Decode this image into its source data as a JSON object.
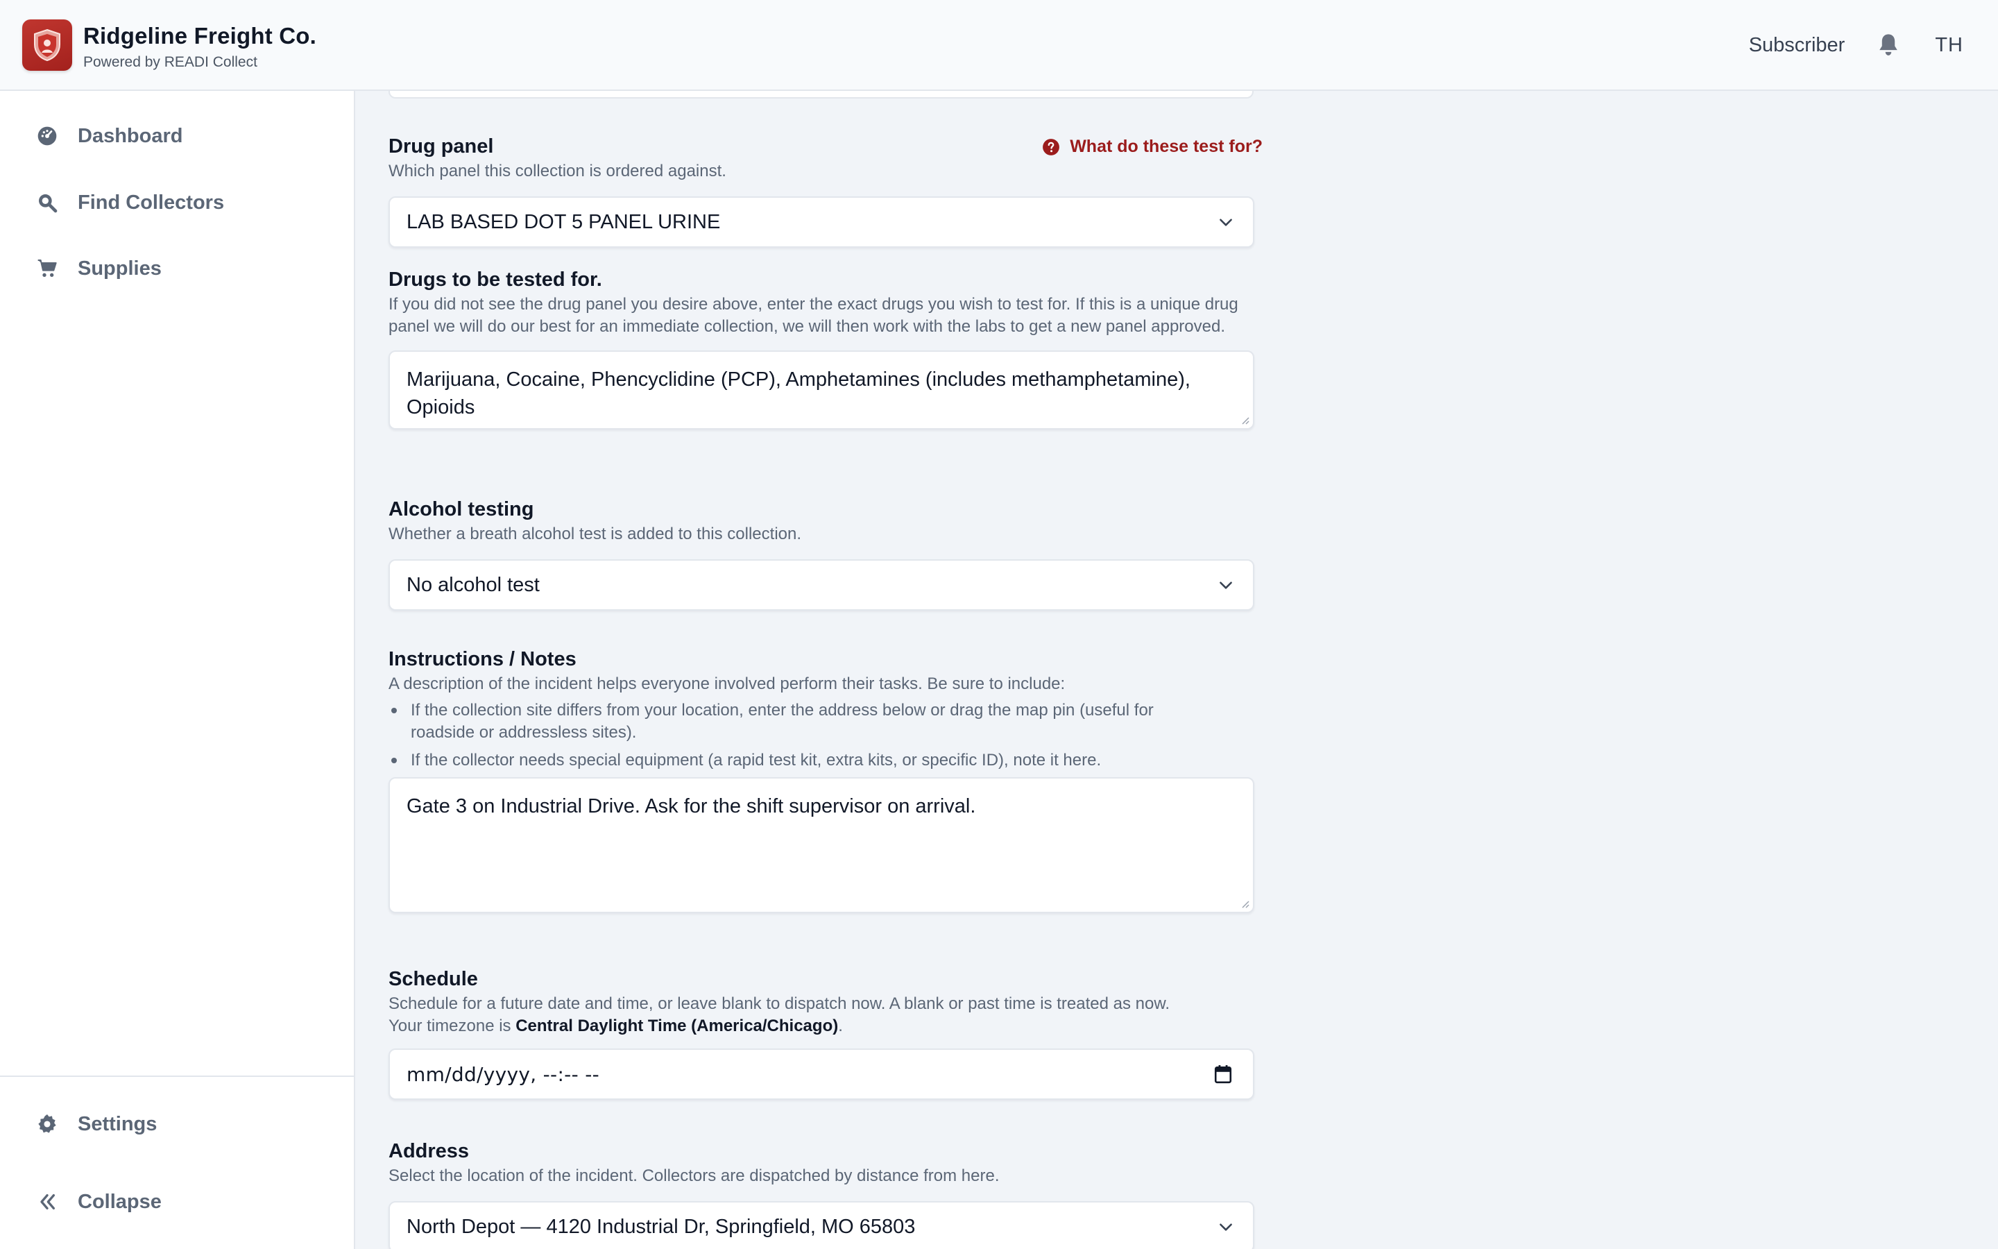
{
  "header": {
    "app_title": "Ridgeline Freight Co.",
    "app_subtitle": "Powered by READI Collect",
    "role": "Subscriber",
    "user_initials": "TH"
  },
  "sidebar": {
    "items": [
      {
        "label": "Dashboard",
        "icon": "dashboard-icon"
      },
      {
        "label": "Find Collectors",
        "icon": "search-icon"
      },
      {
        "label": "Supplies",
        "icon": "cart-icon"
      }
    ],
    "bottom_items": [
      {
        "label": "Settings",
        "icon": "gear-icon"
      },
      {
        "label": "Collapse",
        "icon": "double-chevron-left-icon"
      }
    ]
  },
  "form": {
    "drug_panel": {
      "label": "Drug panel",
      "help_link": "What do these test for?",
      "hint": "Which panel this collection is ordered against.",
      "value": "LAB BASED DOT 5 PANEL URINE"
    },
    "drugs_tested": {
      "label": "Drugs to be tested for.",
      "hint": "If you did not see the drug panel you desire above, enter the exact drugs you wish to test for. If this is a unique drug panel we will do our best for an immediate collection, we will then work with the labs to get a new panel approved.",
      "value": "Marijuana, Cocaine, Phencyclidine (PCP), Amphetamines (includes methamphetamine), Opioids"
    },
    "alcohol": {
      "label": "Alcohol testing",
      "hint": "Whether a breath alcohol test is added to this collection.",
      "value": "No alcohol test"
    },
    "notes": {
      "label": "Instructions / Notes",
      "hint": "A description of the incident helps everyone involved perform their tasks. Be sure to include:",
      "bullets": [
        "If the collection site differs from your location, enter the address below or drag the map pin (useful for roadside or addressless sites).",
        "If the collector needs special equipment (a rapid test kit, extra kits, or specific ID), note it here."
      ],
      "value": "Gate 3 on Industrial Drive. Ask for the shift supervisor on arrival."
    },
    "schedule": {
      "label": "Schedule",
      "hint_line1": "Schedule for a future date and time, or leave blank to dispatch now. A blank or past time is treated as now.",
      "hint_prefix": "Your timezone is ",
      "timezone": "Central Daylight Time (America/Chicago)",
      "hint_suffix": ".",
      "placeholder": "mm/dd/yyyy, --:-- --"
    },
    "address": {
      "label": "Address",
      "hint": "Select the location of the incident. Collectors are dispatched by distance from here.",
      "value": "North Depot — 4120 Industrial Dr, Springfield, MO 65803"
    }
  },
  "colors": {
    "brand_red": "#a3211d",
    "help_link": "#9b1c1c",
    "sidebar_text": "#5b6676",
    "page_bg": "#f1f4f8"
  }
}
